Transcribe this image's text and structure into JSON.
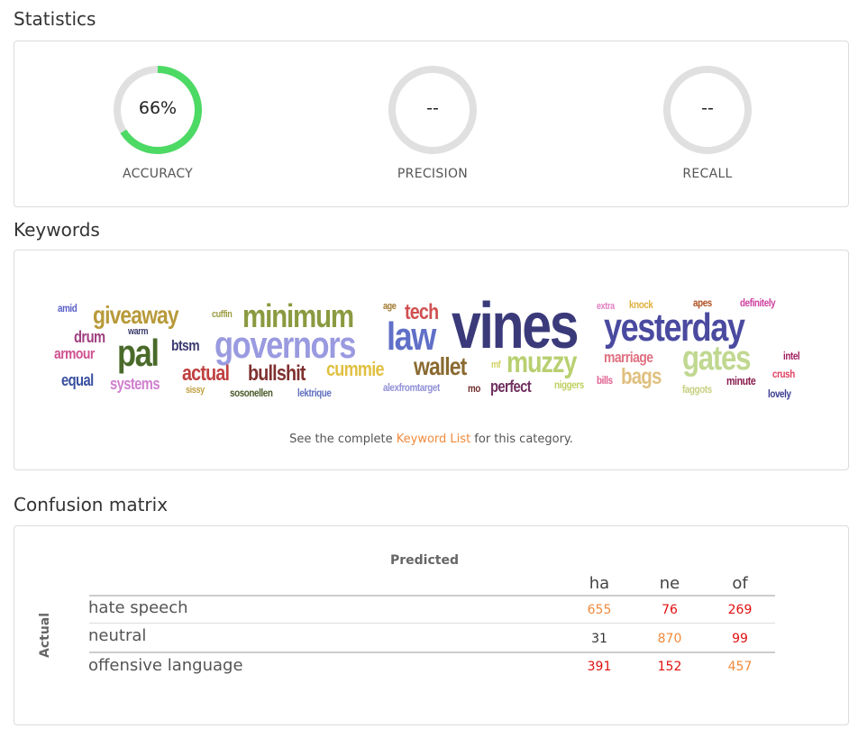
{
  "statistics": {
    "title": "Statistics",
    "items": [
      {
        "label": "ACCURACY",
        "value": "66%",
        "progress": 0.66
      },
      {
        "label": "PRECISION",
        "value": "--",
        "progress": 0
      },
      {
        "label": "RECALL",
        "value": "--",
        "progress": 0
      }
    ],
    "colors": {
      "ring_fill": "#4cd964",
      "ring_track": "#e0e0e0"
    }
  },
  "keywords": {
    "title": "Keywords",
    "words": [
      {
        "text": "amid",
        "color": "#5a5fc8"
      },
      {
        "text": "giveaway",
        "color": "#b89a3a"
      },
      {
        "text": "warm",
        "color": "#3c3c6e"
      },
      {
        "text": "cuffin",
        "color": "#9a9a40"
      },
      {
        "text": "minimum",
        "color": "#8a9a40"
      },
      {
        "text": "age",
        "color": "#a07830"
      },
      {
        "text": "tech",
        "color": "#d05050"
      },
      {
        "text": "vines",
        "color": "#3a3a7a"
      },
      {
        "text": "extra",
        "color": "#e080c0"
      },
      {
        "text": "knock",
        "color": "#e0b040"
      },
      {
        "text": "apes",
        "color": "#b05020"
      },
      {
        "text": "definitely",
        "color": "#d040a0"
      },
      {
        "text": "drum",
        "color": "#a04080"
      },
      {
        "text": "pal",
        "color": "#4a6a2a"
      },
      {
        "text": "btsm",
        "color": "#3a3a70"
      },
      {
        "text": "governors",
        "color": "#9a9ae0"
      },
      {
        "text": "law",
        "color": "#6070c8"
      },
      {
        "text": "yesterday",
        "color": "#4a4aa0"
      },
      {
        "text": "armour",
        "color": "#d05090"
      },
      {
        "text": "intel",
        "color": "#a02060"
      },
      {
        "text": "marriage",
        "color": "#e07080"
      },
      {
        "text": "gates",
        "color": "#c0d890"
      },
      {
        "text": "muzzy",
        "color": "#b8d070"
      },
      {
        "text": "wallet",
        "color": "#8a6a30"
      },
      {
        "text": "mf",
        "color": "#d0d060"
      },
      {
        "text": "cummie",
        "color": "#e0c040"
      },
      {
        "text": "bullshit",
        "color": "#803030"
      },
      {
        "text": "actual",
        "color": "#c04040"
      },
      {
        "text": "crush",
        "color": "#e04060"
      },
      {
        "text": "equal",
        "color": "#3a50a0"
      },
      {
        "text": "systems",
        "color": "#d080d0"
      },
      {
        "text": "bags",
        "color": "#e0c080"
      },
      {
        "text": "bills",
        "color": "#e06090"
      },
      {
        "text": "minute",
        "color": "#8a2050"
      },
      {
        "text": "perfect",
        "color": "#703060"
      },
      {
        "text": "mo",
        "color": "#703030"
      },
      {
        "text": "alexfromtarget",
        "color": "#9090d8"
      },
      {
        "text": "niggers",
        "color": "#c0d060"
      },
      {
        "text": "faggots",
        "color": "#c8d080"
      },
      {
        "text": "lovely",
        "color": "#3a3a90"
      },
      {
        "text": "sissy",
        "color": "#c0a040"
      },
      {
        "text": "sosonellen",
        "color": "#4a5a2a"
      },
      {
        "text": "lektrique",
        "color": "#6070c0"
      }
    ],
    "note_before": "See the complete ",
    "note_link": "Keyword List",
    "note_after": " for this category."
  },
  "confusion_matrix": {
    "title": "Confusion matrix",
    "predicted_label": "Predicted",
    "actual_label": "Actual",
    "columns": [
      "ha",
      "ne",
      "of"
    ],
    "rows": [
      {
        "label": "hate speech",
        "values": [
          "655",
          "76",
          "269"
        ]
      },
      {
        "label": "neutral",
        "values": [
          "31",
          "870",
          "99"
        ]
      },
      {
        "label": "offensive language",
        "values": [
          "391",
          "152",
          "457"
        ]
      }
    ],
    "colors": {
      "diagonal": "#f08a3c",
      "off_diagonal": "#e01010",
      "low": "#333333"
    }
  }
}
